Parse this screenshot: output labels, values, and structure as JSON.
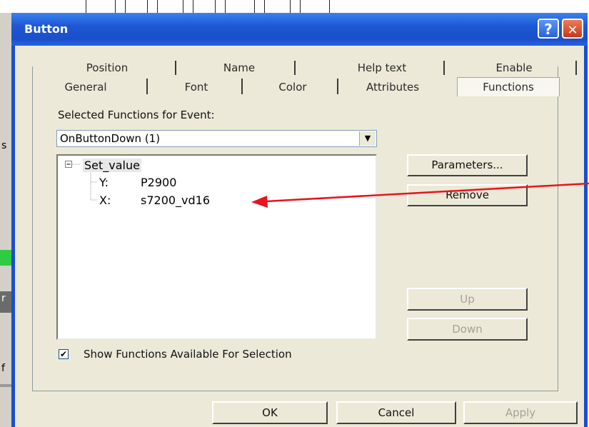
{
  "dialog": {
    "title": "Button",
    "help_glyph": "?",
    "close_glyph": "✕"
  },
  "tabs": {
    "row_back": [
      "Position",
      "Name",
      "Help text",
      "Enable"
    ],
    "row_front": [
      "General",
      "Font",
      "Color",
      "Attributes",
      "Functions"
    ],
    "active": "Functions"
  },
  "functions": {
    "event_label": "Selected Functions for Event:",
    "event_value": "OnButtonDown  (1)",
    "tree": {
      "root": "Set_value",
      "children": [
        {
          "param": "Y:",
          "value": "P2900"
        },
        {
          "param": "X:",
          "value": "s7200_vd16"
        }
      ]
    },
    "buttons": {
      "parameters": "Parameters...",
      "remove": "Remove",
      "up": "Up",
      "down": "Down"
    },
    "show_available_label": "Show Functions Available For Selection",
    "show_available_checked": true
  },
  "footer": {
    "ok": "OK",
    "cancel": "Cancel",
    "apply": "Apply"
  },
  "colors": {
    "annotation_arrow": "#e8141c",
    "titlebar": "#1f56d4"
  },
  "background_glyphs": [
    "s",
    "r",
    "f"
  ]
}
